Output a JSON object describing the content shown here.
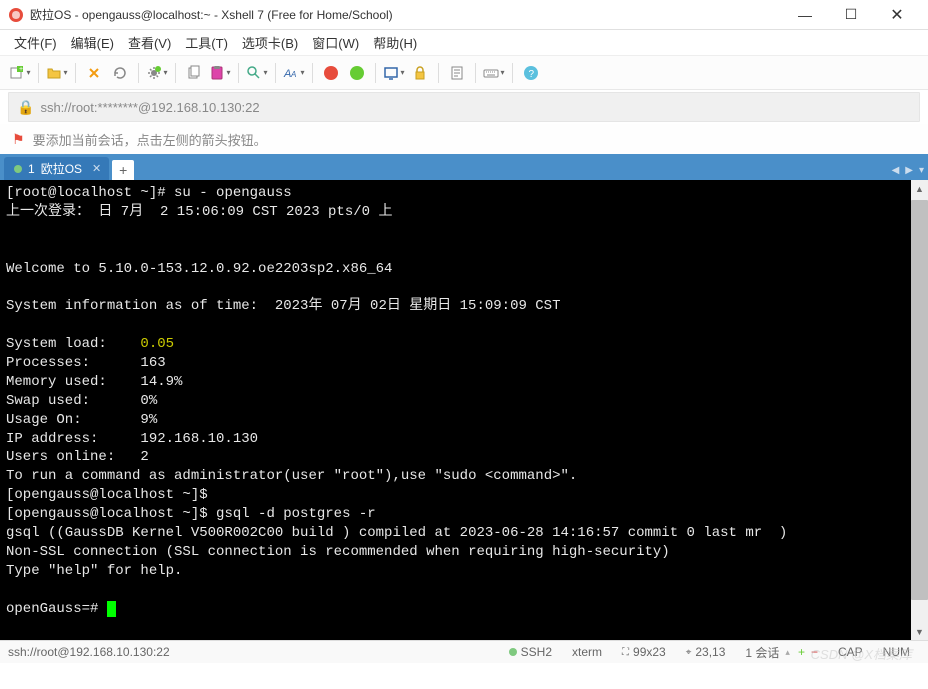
{
  "window": {
    "title": "欧拉OS - opengauss@localhost:~ - Xshell 7 (Free for Home/School)"
  },
  "menubar": {
    "items": [
      "文件(F)",
      "编辑(E)",
      "查看(V)",
      "工具(T)",
      "选项卡(B)",
      "窗口(W)",
      "帮助(H)"
    ]
  },
  "addressbar": {
    "text": "ssh://root:********@192.168.10.130:22"
  },
  "hintbar": {
    "text": "要添加当前会话，点击左侧的箭头按钮。"
  },
  "tabs": {
    "items": [
      {
        "index": "1",
        "label": "欧拉OS"
      }
    ],
    "new_tab": "+"
  },
  "terminal": {
    "line1_prompt": "[root@localhost ~]# ",
    "line1_cmd": "su - opengauss",
    "line2": "上一次登录： 日 7月  2 15:06:09 CST 2023 pts/0 上",
    "line3": "Welcome to 5.10.0-153.12.0.92.oe2203sp2.x86_64",
    "line4": "System information as of time:  2023年 07月 02日 星期日 15:09:09 CST",
    "line5_label": "System load:    ",
    "line5_val": "0.05",
    "line6": "Processes:      163",
    "line7": "Memory used:    14.9%",
    "line8": "Swap used:      0%",
    "line9": "Usage On:       9%",
    "line10": "IP address:     192.168.10.130",
    "line11": "Users online:   2",
    "line12": "To run a command as administrator(user \"root\"),use \"sudo <command>\".",
    "line13": "[opengauss@localhost ~]$",
    "line14_prompt": "[opengauss@localhost ~]$ ",
    "line14_cmd": "gsql -d postgres -r",
    "line15": "gsql ((GaussDB Kernel V500R002C00 build ) compiled at 2023-06-28 14:16:57 commit 0 last mr  )",
    "line16": "Non-SSL connection (SSL connection is recommended when requiring high-security)",
    "line17": "Type \"help\" for help.",
    "line18": "openGauss=# "
  },
  "statusbar": {
    "conn": "ssh://root@192.168.10.130:22",
    "ssh": "SSH2",
    "term": "xterm",
    "size": "99x23",
    "pos": "23,13",
    "sessions": "1 会话",
    "cap": "CAP",
    "num": "NUM"
  },
  "watermark": "CSDN @X档案库"
}
